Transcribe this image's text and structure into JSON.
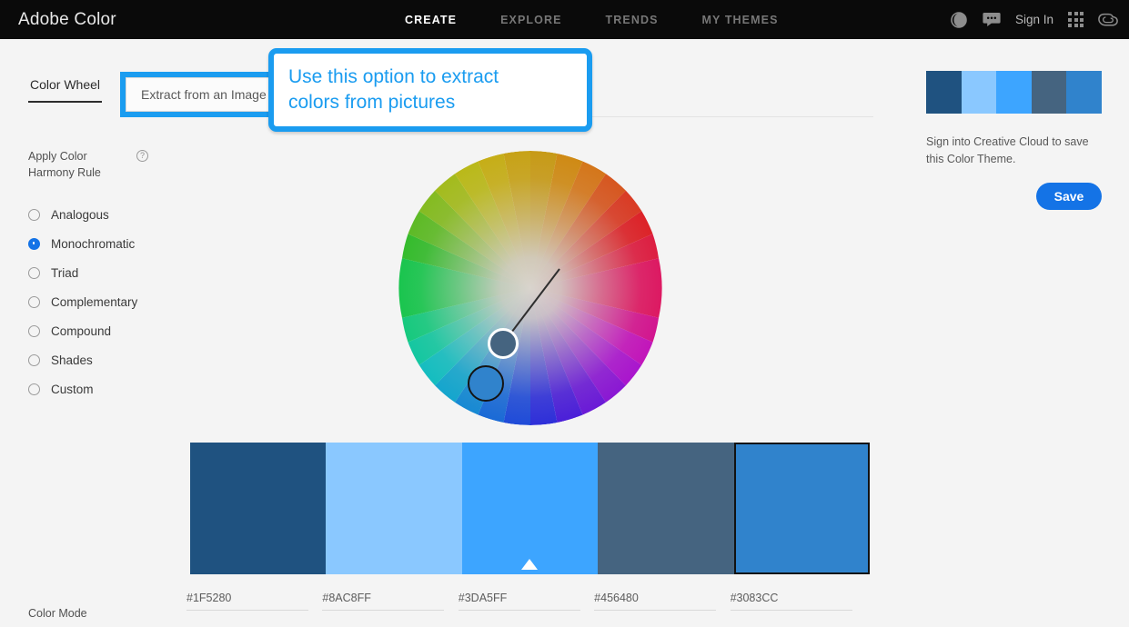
{
  "app": {
    "brand": "Adobe Color"
  },
  "topnav": {
    "items": [
      {
        "label": "CREATE",
        "active": true
      },
      {
        "label": "EXPLORE",
        "active": false
      },
      {
        "label": "TRENDS",
        "active": false
      },
      {
        "label": "MY THEMES",
        "active": false
      }
    ],
    "tools": {
      "contrast_icon": "contrast-circle-icon",
      "feedback_icon": "chat-bubble-icon",
      "sign_in": "Sign In",
      "app_grid_icon": "app-grid-icon",
      "creative_cloud_icon": "creative-cloud-icon"
    }
  },
  "tabs": {
    "color_wheel": "Color Wheel",
    "extract": "Extract from an Image",
    "active": "Color Wheel"
  },
  "callout": {
    "line1": "Use this option to extract",
    "line2": "colors from pictures",
    "border_color": "#1A9CF0",
    "text_color": "#1A9CF0"
  },
  "harmony": {
    "label": "Apply Color Harmony Rule",
    "help_icon": "help-circle-icon",
    "selected": "Monochromatic",
    "rules": [
      {
        "label": "Analogous",
        "selected": false
      },
      {
        "label": "Monochromatic",
        "selected": true
      },
      {
        "label": "Triad",
        "selected": false
      },
      {
        "label": "Complementary",
        "selected": false
      },
      {
        "label": "Compound",
        "selected": false
      },
      {
        "label": "Shades",
        "selected": false
      },
      {
        "label": "Custom",
        "selected": false
      }
    ]
  },
  "wheel": {
    "markers": [
      {
        "name": "secondary-handle",
        "fill": "#456480",
        "ring": "#FFFFFF"
      },
      {
        "name": "primary-handle",
        "fill": "#3083CC",
        "ring": "#141414"
      }
    ]
  },
  "theme": {
    "swatches": [
      {
        "hex": "#1F5280",
        "base": false,
        "selected": false
      },
      {
        "hex": "#8AC8FF",
        "base": false,
        "selected": false
      },
      {
        "hex": "#3DA5FF",
        "base": true,
        "selected": false
      },
      {
        "hex": "#456480",
        "base": false,
        "selected": false
      },
      {
        "hex": "#3083CC",
        "base": false,
        "selected": true
      }
    ]
  },
  "footer": {
    "color_mode_label": "Color Mode"
  },
  "right_panel": {
    "save_text": "Sign into Creative Cloud to save this Color Theme.",
    "save_label": "Save",
    "save_color": "#1473E6"
  }
}
